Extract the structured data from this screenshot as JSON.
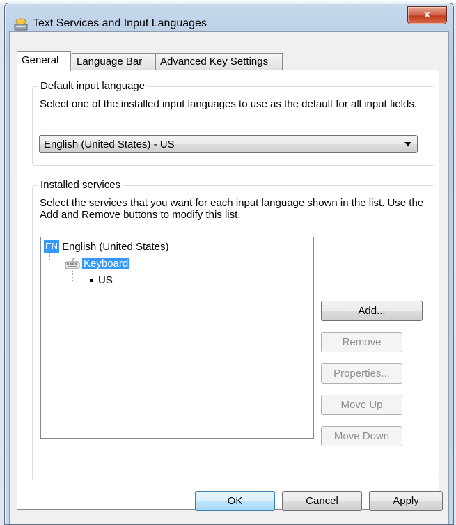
{
  "window": {
    "title": "Text Services and Input Languages",
    "close_label": "x"
  },
  "tabs": [
    {
      "label": "General",
      "active": true
    },
    {
      "label": "Language Bar",
      "active": false
    },
    {
      "label": "Advanced Key Settings",
      "active": false
    }
  ],
  "default_input": {
    "group_label": "Default input language",
    "description": "Select one of the installed input languages to use as the default for all input fields.",
    "selected_value": "English (United States) - US"
  },
  "installed_services": {
    "group_label": "Installed services",
    "description": "Select the services that you want for each input language shown in the list. Use the Add and Remove buttons to modify this list.",
    "tree": {
      "language_badge": "EN",
      "language": "English (United States)",
      "category": "Keyboard",
      "layout": "US"
    },
    "buttons": {
      "add": "Add...",
      "remove": "Remove",
      "properties": "Properties...",
      "move_up": "Move Up",
      "move_down": "Move Down"
    }
  },
  "footer": {
    "ok": "OK",
    "cancel": "Cancel",
    "apply": "Apply"
  },
  "colors": {
    "selection": "#3399ff",
    "close_button": "#c23a1d"
  }
}
